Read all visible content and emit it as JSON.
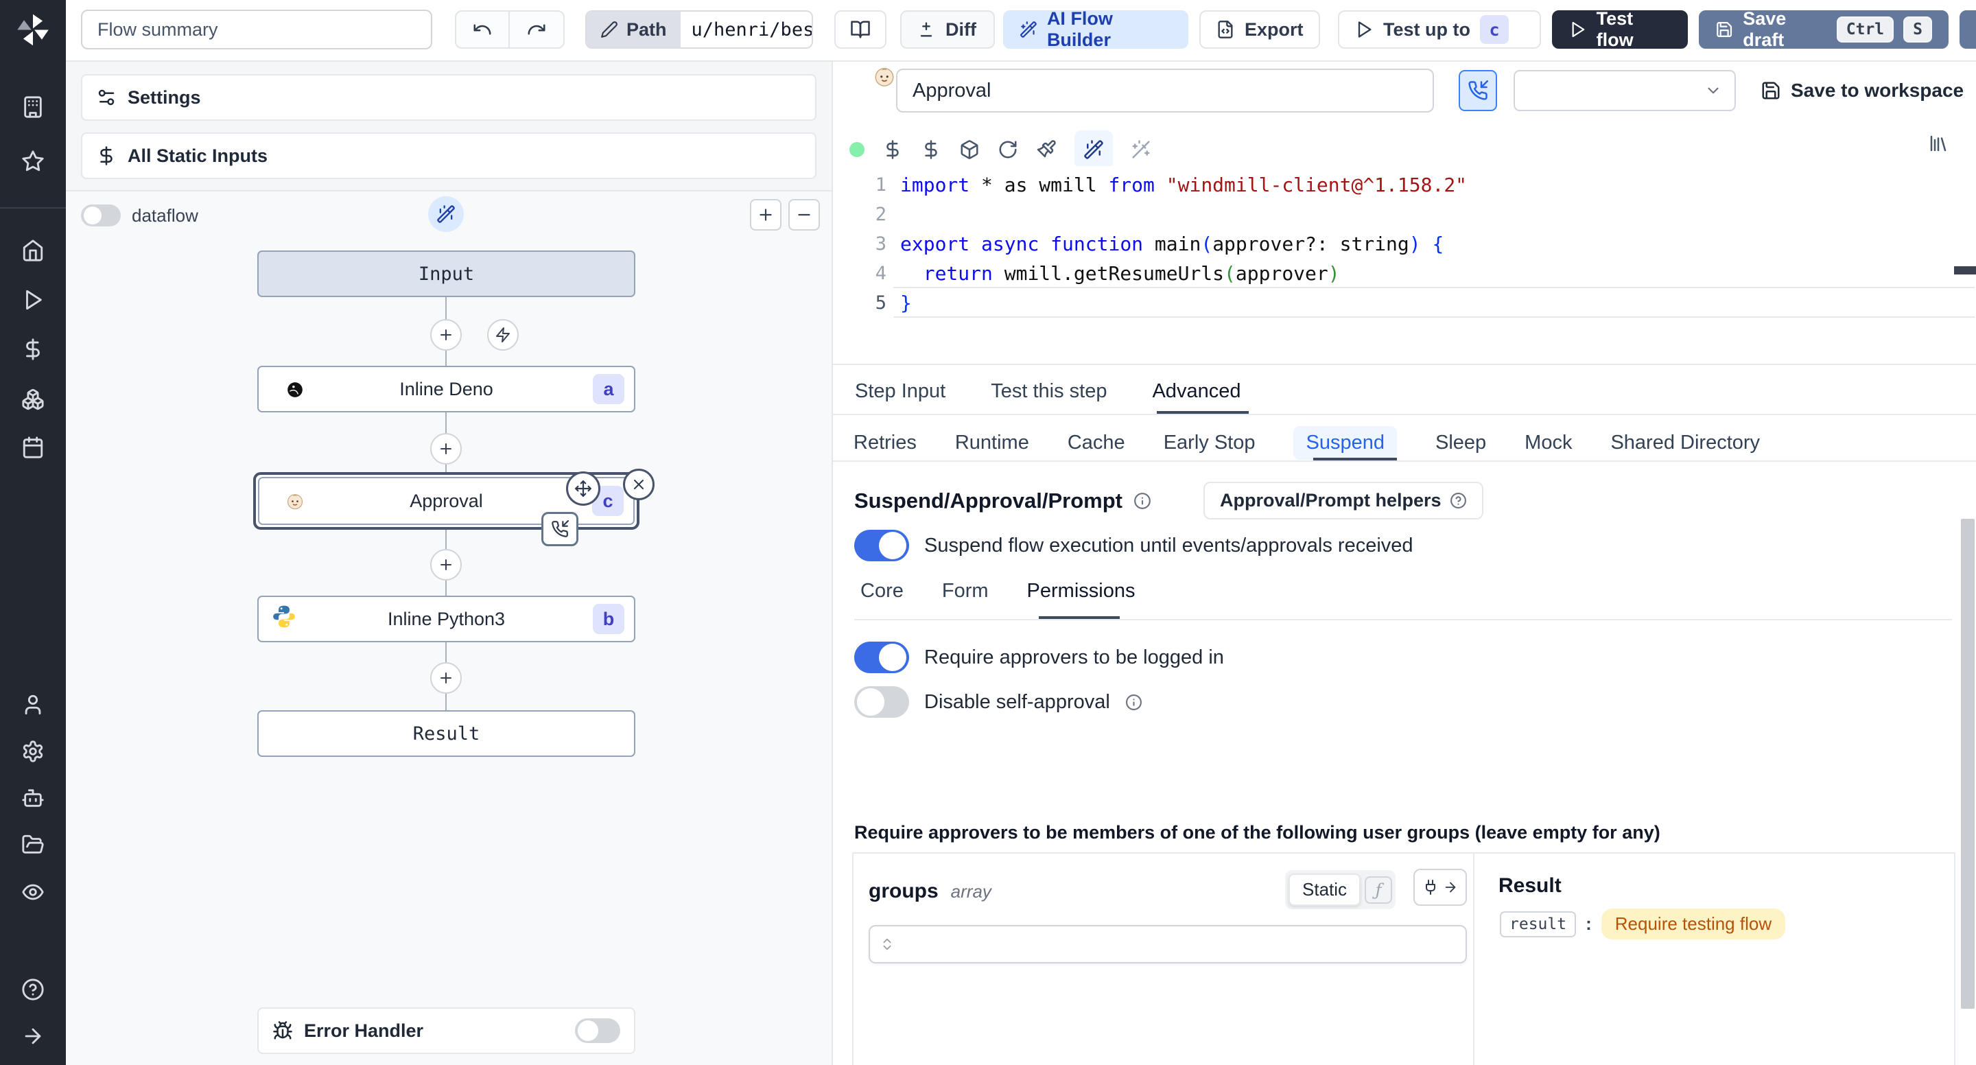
{
  "topbar": {
    "flow_summary": "Flow summary",
    "path_label": "Path",
    "path_value": "u/henri/bes",
    "diff_label": "Diff",
    "ai_flow_builder_label": "AI Flow Builder",
    "export_label": "Export",
    "test_up_to_label": "Test up to",
    "test_up_to_badge": "c",
    "test_flow_label": "Test flow",
    "save_draft_label": "Save draft",
    "save_draft_kbd_ctrl": "Ctrl",
    "save_draft_kbd_s": "S"
  },
  "sidebar": {
    "icons": [
      "windmill-logo",
      "building",
      "star",
      "home",
      "play",
      "dollar",
      "boxes",
      "calendar",
      "user",
      "gear",
      "bot",
      "folder-open",
      "eye",
      "help-circle",
      "arrow-right"
    ]
  },
  "flow_panel": {
    "settings_label": "Settings",
    "static_inputs_label": "All Static Inputs",
    "dataflow_label": "dataflow",
    "nodes": {
      "input_label": "Input",
      "deno_label": "Inline Deno",
      "deno_badge": "a",
      "approval_label": "Approval",
      "approval_badge": "c",
      "python_label": "Inline Python3",
      "python_badge": "b",
      "result_label": "Result"
    },
    "error_handler_label": "Error Handler"
  },
  "step_header": {
    "name_value": "Approval",
    "save_to_workspace_label": "Save to workspace"
  },
  "editor": {
    "line_numbers": [
      "1",
      "2",
      "3",
      "4",
      "5"
    ],
    "lines": [
      [
        [
          "import",
          "kw"
        ],
        [
          " * as wmill ",
          "def"
        ],
        [
          "from",
          "kw"
        ],
        [
          " ",
          "def"
        ],
        [
          "\"windmill-client@^1.158.2\"",
          "str"
        ]
      ],
      [],
      [
        [
          "export",
          "kw"
        ],
        [
          " ",
          "def"
        ],
        [
          "async",
          "kw"
        ],
        [
          " ",
          "def"
        ],
        [
          "function",
          "kw"
        ],
        [
          " main",
          "def"
        ],
        [
          "(",
          "b1"
        ],
        [
          "approver?: string",
          "def"
        ],
        [
          ")",
          "b1"
        ],
        [
          " {",
          "b1"
        ]
      ],
      [
        [
          "  ",
          "def"
        ],
        [
          "return",
          "kw"
        ],
        [
          " wmill.getResumeUrls",
          "def"
        ],
        [
          "(",
          "b2"
        ],
        [
          "approver",
          "def"
        ],
        [
          ")",
          "b2"
        ]
      ],
      [
        [
          "}",
          "b1"
        ]
      ]
    ]
  },
  "tabs": {
    "main": [
      {
        "label": "Step Input",
        "active": false
      },
      {
        "label": "Test this step",
        "active": false
      },
      {
        "label": "Advanced",
        "active": true
      }
    ],
    "advanced": [
      {
        "label": "Retries",
        "active": false
      },
      {
        "label": "Runtime",
        "active": false
      },
      {
        "label": "Cache",
        "active": false
      },
      {
        "label": "Early Stop",
        "active": false
      },
      {
        "label": "Suspend",
        "active": true
      },
      {
        "label": "Sleep",
        "active": false
      },
      {
        "label": "Mock",
        "active": false
      },
      {
        "label": "Shared Directory",
        "active": false
      }
    ]
  },
  "suspend": {
    "title": "Suspend/Approval/Prompt",
    "helpers_button_label": "Approval/Prompt helpers",
    "suspend_toggle_label": "Suspend flow execution until events/approvals received",
    "sub_tabs": [
      {
        "label": "Core",
        "active": false
      },
      {
        "label": "Form",
        "active": false
      },
      {
        "label": "Permissions",
        "active": true
      }
    ],
    "require_login_label": "Require approvers to be logged in",
    "disable_self_approval_label": "Disable self-approval",
    "groups_heading": "Require approvers to be members of one of the following user groups (leave empty for any)",
    "groups_field": {
      "name": "groups",
      "type": "array",
      "static_label": "Static",
      "fx_label": "ƒ"
    },
    "result_panel": {
      "title": "Result",
      "key": "result",
      "colon": ":",
      "value": "Require testing flow"
    }
  },
  "colors": {
    "toggle_on": "#3b6ce6",
    "accent_blue": "#2563eb",
    "ai_button_bg": "#dbeafe",
    "test_flow_bg": "#252b3b",
    "save_draft_bg": "#64789c",
    "result_pill_bg": "#fdf3c4",
    "result_pill_text": "#b45309",
    "badge_bg": "#dfe3fb",
    "badge_text": "#4040c0"
  }
}
